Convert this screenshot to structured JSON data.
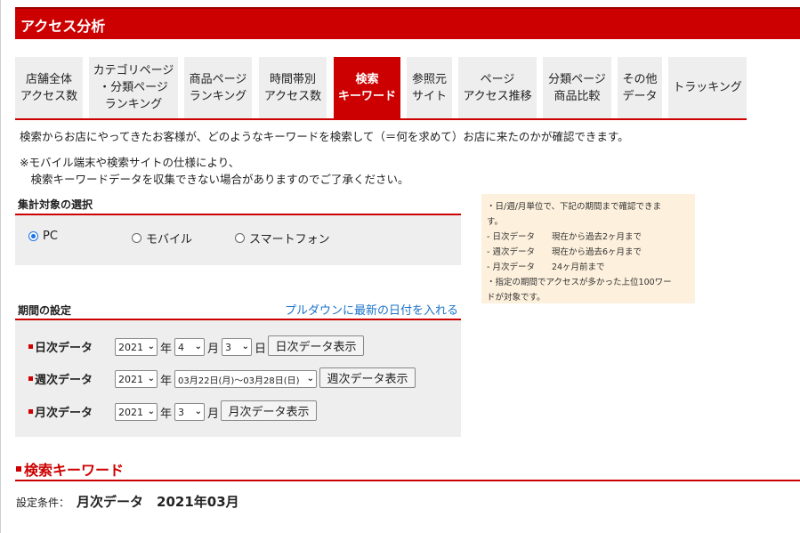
{
  "header": {
    "title": "アクセス分析"
  },
  "tabs": [
    {
      "label": "店舗全体\nアクセス数"
    },
    {
      "label": "カテゴリページ\n・分類ページ\nランキング"
    },
    {
      "label": "商品ページ\nランキング"
    },
    {
      "label": "時間帯別\nアクセス数"
    },
    {
      "label": "検索\nキーワード",
      "active": true
    },
    {
      "label": "参照元\nサイト"
    },
    {
      "label": "ページ\nアクセス推移"
    },
    {
      "label": "分類ページ\n商品比較"
    },
    {
      "label": "その他\nデータ"
    },
    {
      "label": "トラッキング"
    }
  ],
  "description": "検索からお店にやってきたお客様が、どのようなキーワードを検索して（＝何を求めて）お店に来たのかが確認できます。",
  "note": "※モバイル端末や検索サイトの仕様により、\n　検索キーワードデータを収集できない場合がありますのでご了承ください。",
  "target": {
    "title": "集計対象の選択",
    "options": [
      {
        "label": "PC",
        "selected": true
      },
      {
        "label": "モバイル",
        "selected": false
      },
      {
        "label": "スマートフォン",
        "selected": false
      }
    ]
  },
  "info": {
    "text": "・日/週/月単位で、下記の期間まで確認できま\nす。\n- 日次データ　　現在から過去2ヶ月まで\n- 週次データ　　現在から過去6ヶ月まで\n- 月次データ　　24ヶ月前まで\n・指定の期間でアクセスが多かった上位100ワー\nドが対象です。"
  },
  "period": {
    "title": "期間の設定",
    "link": "プルダウンに最新の日付を入れる",
    "daily": {
      "label": "日次データ",
      "year": "2021",
      "year_unit": "年",
      "month": "4",
      "month_unit": "月",
      "day": "3",
      "day_unit": "日",
      "button": "日次データ表示"
    },
    "weekly": {
      "label": "週次データ",
      "year": "2021",
      "year_unit": "年",
      "week": "03月22日(月)～03月28日(日)",
      "button": "週次データ表示"
    },
    "monthly": {
      "label": "月次データ",
      "year": "2021",
      "year_unit": "年",
      "month": "3",
      "month_unit": "月",
      "button": "月次データ表示"
    }
  },
  "keyword_section": {
    "title": "検索キーワード",
    "condition_label": "設定条件：",
    "condition_value": "月次データ　2021年03月"
  },
  "colors": {
    "accent": "#cc0000",
    "panel": "#eeeeee",
    "info_bg": "#fdf0dc",
    "link": "#1a73c8"
  },
  "icons": [
    "radio-selected-icon",
    "radio-unselected-icon",
    "chevron-down-icon",
    "red-square-bullet-icon"
  ]
}
